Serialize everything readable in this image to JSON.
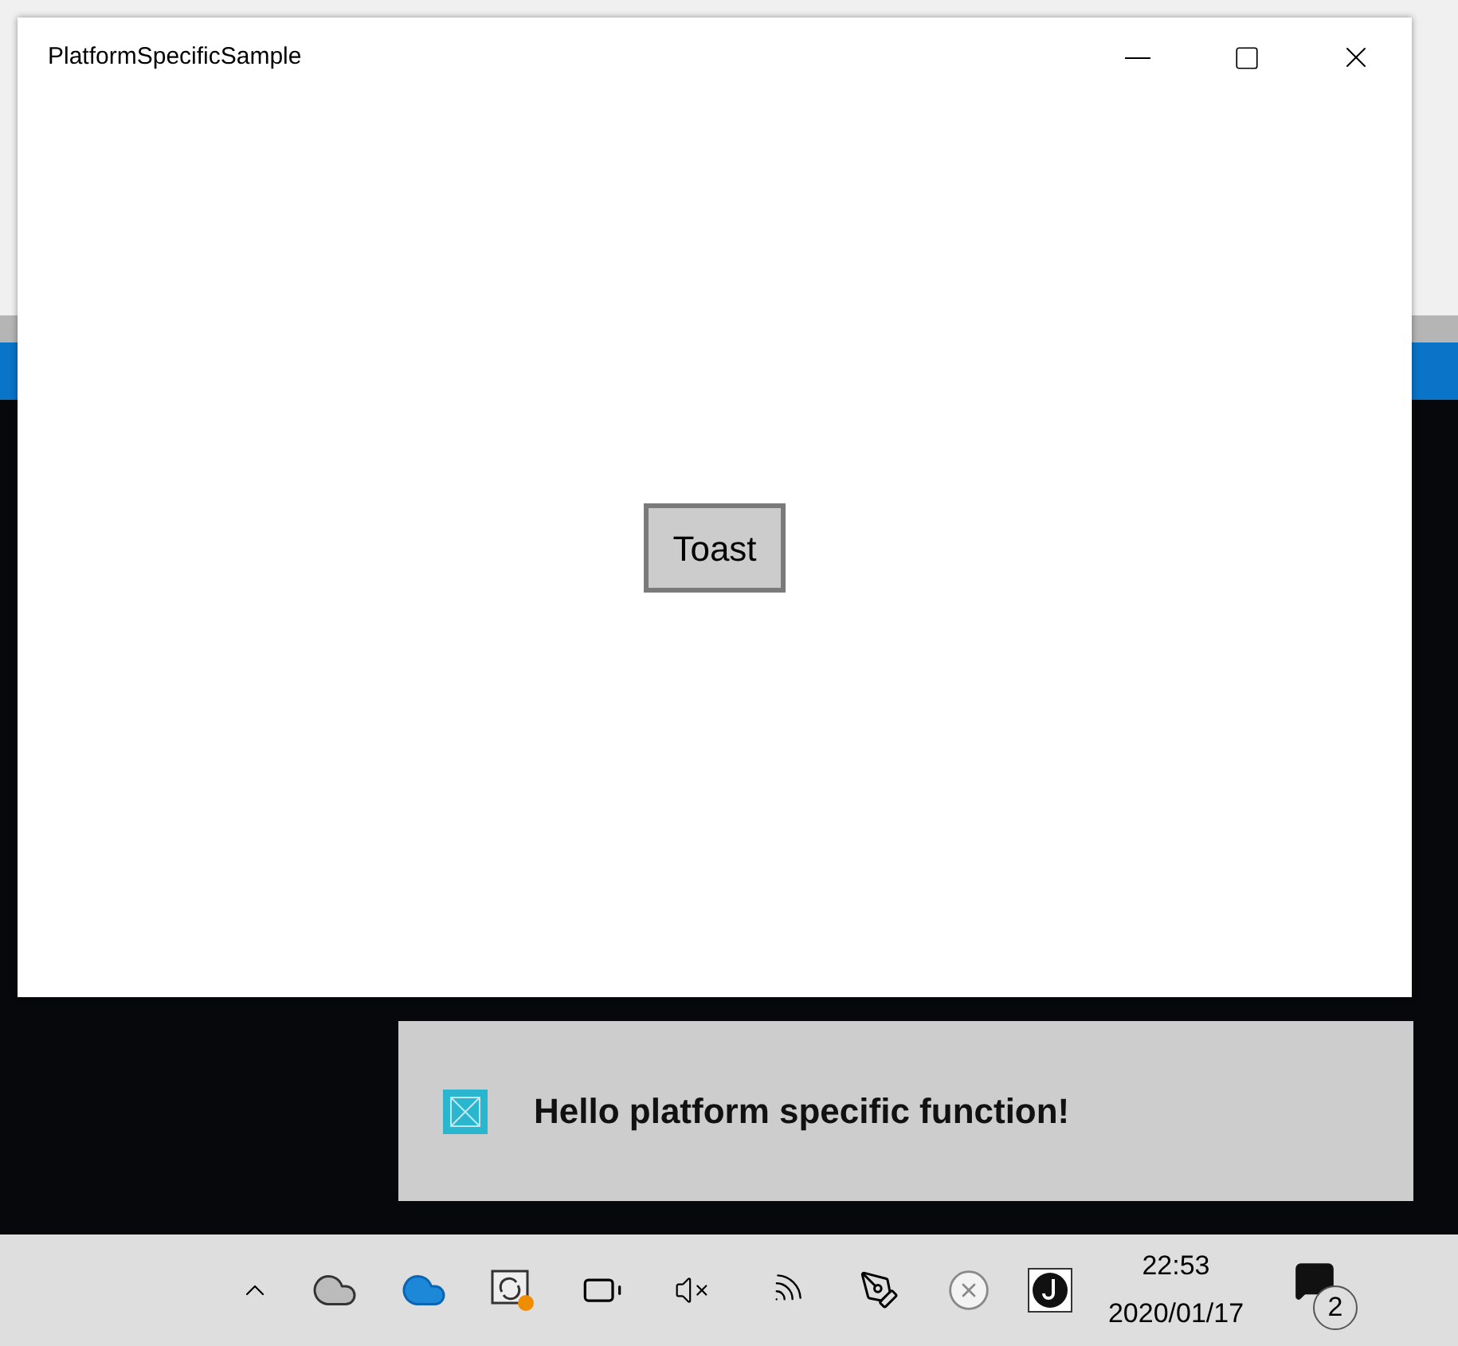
{
  "window": {
    "title": "PlatformSpecificSample"
  },
  "content": {
    "button": "Toast"
  },
  "toast": {
    "message": "Hello platform specific function!"
  },
  "taskbar": {
    "time": "22:53",
    "date": "2020/01/17",
    "notification_count": "2"
  }
}
